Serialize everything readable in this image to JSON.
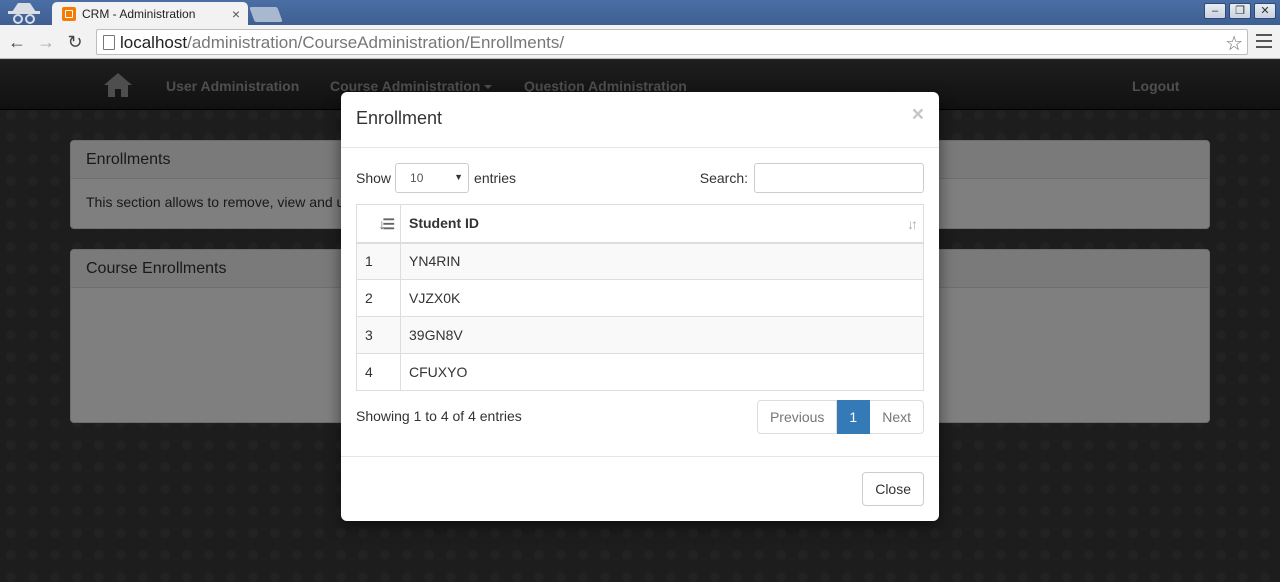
{
  "browser": {
    "tab_title": "CRM - Administration",
    "tab_close": "×",
    "url_host": "localhost",
    "url_path": "/administration/CourseAdministration/Enrollments/",
    "window_buttons": [
      "–",
      "❐",
      "✕"
    ]
  },
  "nav": {
    "links": [
      "User Administration",
      "Course Administration",
      "Question Administration"
    ],
    "logout": "Logout"
  },
  "panels": {
    "enrollments": {
      "title": "Enrollments",
      "body": "This section allows to remove, view and u"
    },
    "course_enrollments": {
      "title": "Course Enrollments"
    }
  },
  "modal": {
    "title": "Enrollment",
    "close_x": "×",
    "show_label": "Show",
    "length_value": "10",
    "entries_label": "entries",
    "search_label": "Search:",
    "search_value": "",
    "columns": [
      "",
      "Student ID"
    ],
    "rows": [
      [
        "1",
        "YN4RIN"
      ],
      [
        "2",
        "VJZX0K"
      ],
      [
        "3",
        "39GN8V"
      ],
      [
        "4",
        "CFUXYO"
      ]
    ],
    "info": "Showing 1 to 4 of 4 entries",
    "pagination": {
      "previous": "Previous",
      "current": "1",
      "next": "Next"
    },
    "close_button": "Close"
  },
  "colors": {
    "nav_bg": "#222222",
    "active_page": "#337ab7"
  }
}
